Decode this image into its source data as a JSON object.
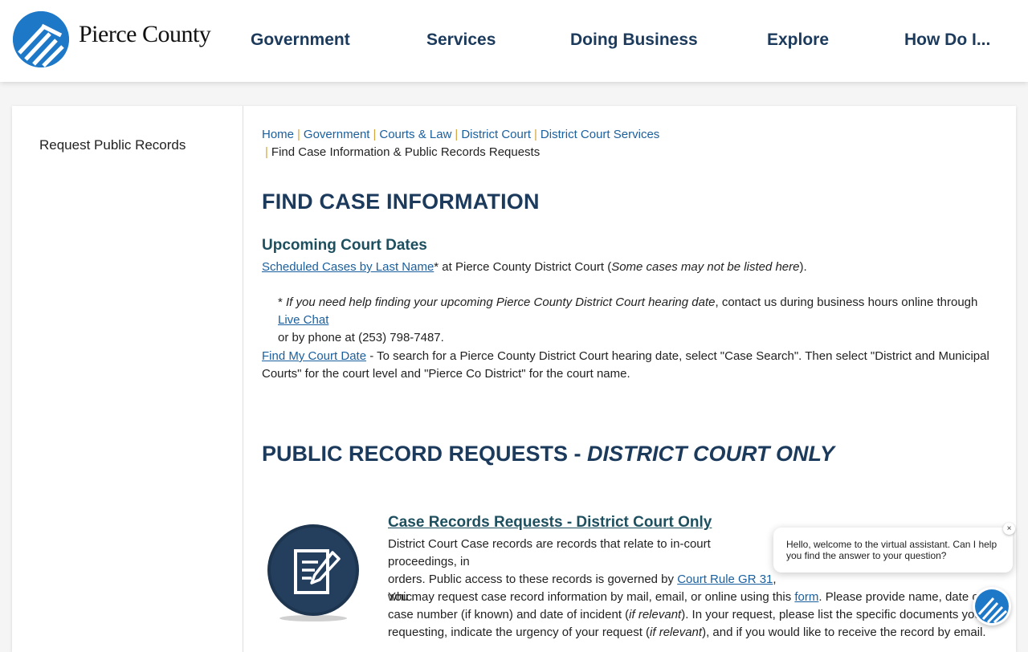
{
  "header": {
    "logo_text": "Pierce County",
    "nav": [
      {
        "label": "Government"
      },
      {
        "label": "Services"
      },
      {
        "label": "Doing Business"
      },
      {
        "label": "Explore"
      },
      {
        "label": "How Do I..."
      }
    ]
  },
  "sidebar": {
    "items": [
      {
        "label": "Request Public Records"
      }
    ]
  },
  "breadcrumb": {
    "items": [
      "Home",
      "Government",
      "Courts & Law",
      "District Court",
      "District Court Services"
    ],
    "current": "Find Case Information & Public Records Requests"
  },
  "main": {
    "title": "FIND CASE INFORMATION",
    "upcoming": {
      "heading": "Upcoming Court Dates",
      "link1": "Scheduled Cases by Last Name",
      "text1": "* at Pierce County District Court (",
      "text1_italic": "Some cases may not be listed here",
      "text1_end": ").",
      "note_star": "* ",
      "note_italic": "If you need help finding your upcoming Pierce County District Court hearing date",
      "note_text": ", contact us during business hours online through ",
      "note_link": "Live Chat",
      "note_text2": "or by phone at (253) 798-7487.",
      "find_link": "Find My Court Date",
      "find_text": " - To search for a Pierce County District Court hearing date, select \"Case Search\".  Then select \"District and Municipal Courts\" for the court level and \"Pierce Co District\" for the court name."
    },
    "public_records": {
      "heading_plain": "PUBLIC RECORD REQUESTS - ",
      "heading_italic": "DISTRICT COURT ONLY",
      "case_link": "Case Records Requests - District Court Only",
      "desc1": "District Court Case records are records that relate to in-court proceedings, in",
      "desc2a": "orders. Public access to these records is governed by ",
      "desc2_link": "Court Rule GR 31",
      "desc2b": ", whic",
      "req_text_a": "You may request case record information by mail, email, or online using this ",
      "req_link": "form",
      "req_text_b": ".  Please provide name, date of birt",
      "req_line2a": "case number (if known) and date of incident (",
      "req_line2_italic": "if relevant",
      "req_line2b": ").  In your request, please list the specific documents you a",
      "req_line3a": "requesting, indicate the urgency of your request (",
      "req_line3_italic": "if relevant",
      "req_line3b": "), and if you would like to receive the record by email."
    }
  },
  "chat": {
    "message": "Hello, welcome to the virtual assistant. Can I help you find the answer to your question?",
    "close": "×"
  },
  "colors": {
    "heading": "#1b3a5c",
    "subheading": "#1d4f5f",
    "link": "#1a5f9e",
    "breadcrumb_sep": "#d4a53a",
    "logo_blue": "#1e78c8"
  }
}
